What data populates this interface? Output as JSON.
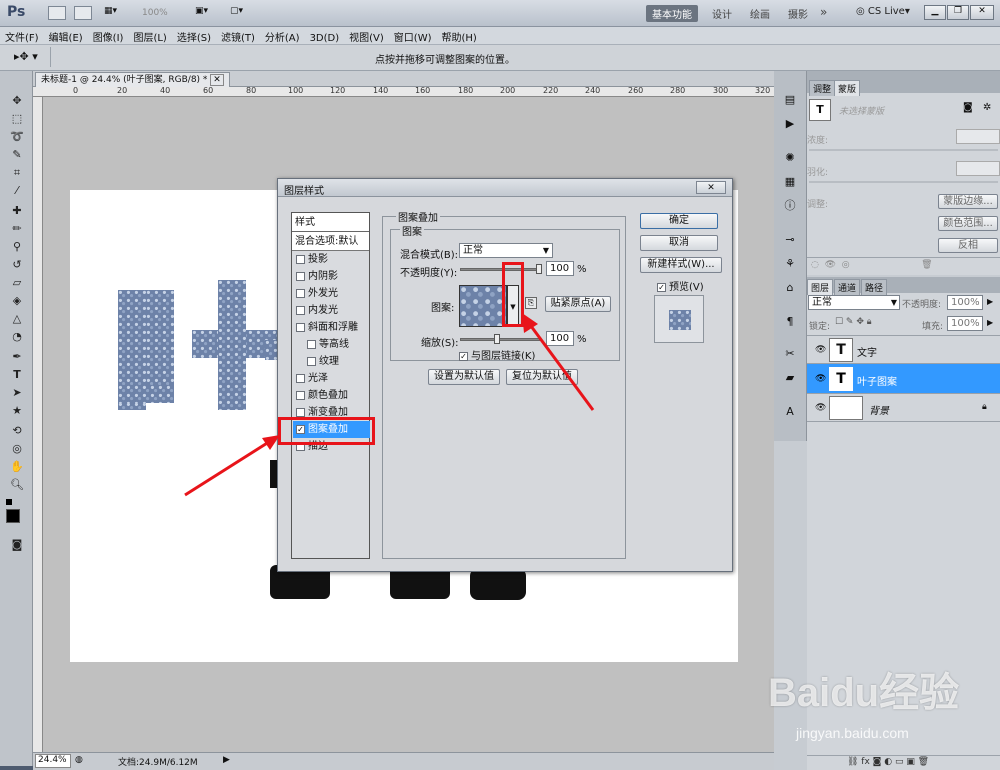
{
  "app": {
    "logo": "Ps",
    "zoom_dropdown": "100%",
    "workspaces": [
      "基本功能",
      "设计",
      "绘画",
      "摄影"
    ],
    "more": "»",
    "cslive": "CS Live"
  },
  "menu": [
    "文件(F)",
    "编辑(E)",
    "图像(I)",
    "图层(L)",
    "选择(S)",
    "滤镜(T)",
    "分析(A)",
    "3D(D)",
    "视图(V)",
    "窗口(W)",
    "帮助(H)"
  ],
  "options": {
    "hint": "点按并拖移可调整图案的位置。"
  },
  "document": {
    "tab_title": "未标题-1 @ 24.4% (叶子图案, RGB/8) *",
    "ruler_marks": [
      "0",
      "20",
      "40",
      "60",
      "80",
      "100",
      "120",
      "140",
      "160",
      "180",
      "200",
      "220",
      "240",
      "260",
      "280",
      "300",
      "320"
    ],
    "canvas_text": "叶子",
    "zoom": "24.4%",
    "doc_info": "文档:24.9M/6.12M"
  },
  "dialog": {
    "title": "图层样式",
    "styles_header": "样式",
    "blend_default": "混合选项:默认",
    "effects": [
      {
        "label": "投影",
        "checked": false,
        "sub": false
      },
      {
        "label": "内阴影",
        "checked": false,
        "sub": false
      },
      {
        "label": "外发光",
        "checked": false,
        "sub": false
      },
      {
        "label": "内发光",
        "checked": false,
        "sub": false
      },
      {
        "label": "斜面和浮雕",
        "checked": false,
        "sub": false
      },
      {
        "label": "等高线",
        "checked": false,
        "sub": true
      },
      {
        "label": "纹理",
        "checked": false,
        "sub": true
      },
      {
        "label": "光泽",
        "checked": false,
        "sub": false
      },
      {
        "label": "颜色叠加",
        "checked": false,
        "sub": false
      },
      {
        "label": "渐变叠加",
        "checked": false,
        "sub": false
      },
      {
        "label": "图案叠加",
        "checked": true,
        "sub": false,
        "selected": true
      },
      {
        "label": "描边",
        "checked": false,
        "sub": false
      }
    ],
    "group_title": "图案叠加",
    "subgroup_title": "图案",
    "blend_mode_label": "混合模式(B):",
    "blend_mode_value": "正常",
    "opacity_label": "不透明度(Y):",
    "opacity_value": "100",
    "opacity_unit": "%",
    "pattern_label": "图案:",
    "snap_button": "贴紧原点(A)",
    "scale_label": "缩放(S):",
    "scale_value": "100",
    "scale_unit": "%",
    "link_label": "与图层链接(K)",
    "link_checked": true,
    "set_default": "设置为默认值",
    "reset_default": "复位为默认值",
    "ok": "确定",
    "cancel": "取消",
    "new_style": "新建样式(W)...",
    "preview": "预览(V)",
    "preview_checked": true
  },
  "masks_panel": {
    "tabs": [
      "调整",
      "蒙版"
    ],
    "hint": "未选择蒙版",
    "density": "浓度:",
    "feather": "羽化:",
    "adjust": "调整:",
    "mask_edge": "蒙版边缘...",
    "color_range": "颜色范围...",
    "invert": "反相"
  },
  "layers_panel": {
    "tabs": [
      "图层",
      "通道",
      "路径"
    ],
    "blend_mode": "正常",
    "opacity_label": "不透明度:",
    "opacity_value": "100%",
    "lock_label": "锁定:",
    "fill_label": "填充:",
    "fill_value": "100%",
    "layers": [
      {
        "name": "文字",
        "type": "text",
        "selected": false
      },
      {
        "name": "叶子图案",
        "type": "text",
        "selected": true
      },
      {
        "name": "背景",
        "type": "image",
        "selected": false
      }
    ]
  },
  "watermark": {
    "brand": "Baidu经验",
    "url": "jingyan.baidu.com"
  },
  "colors": {
    "accent": "#3399ff",
    "red_annotation": "#e8141a",
    "workspace_active": "#6b7480"
  }
}
